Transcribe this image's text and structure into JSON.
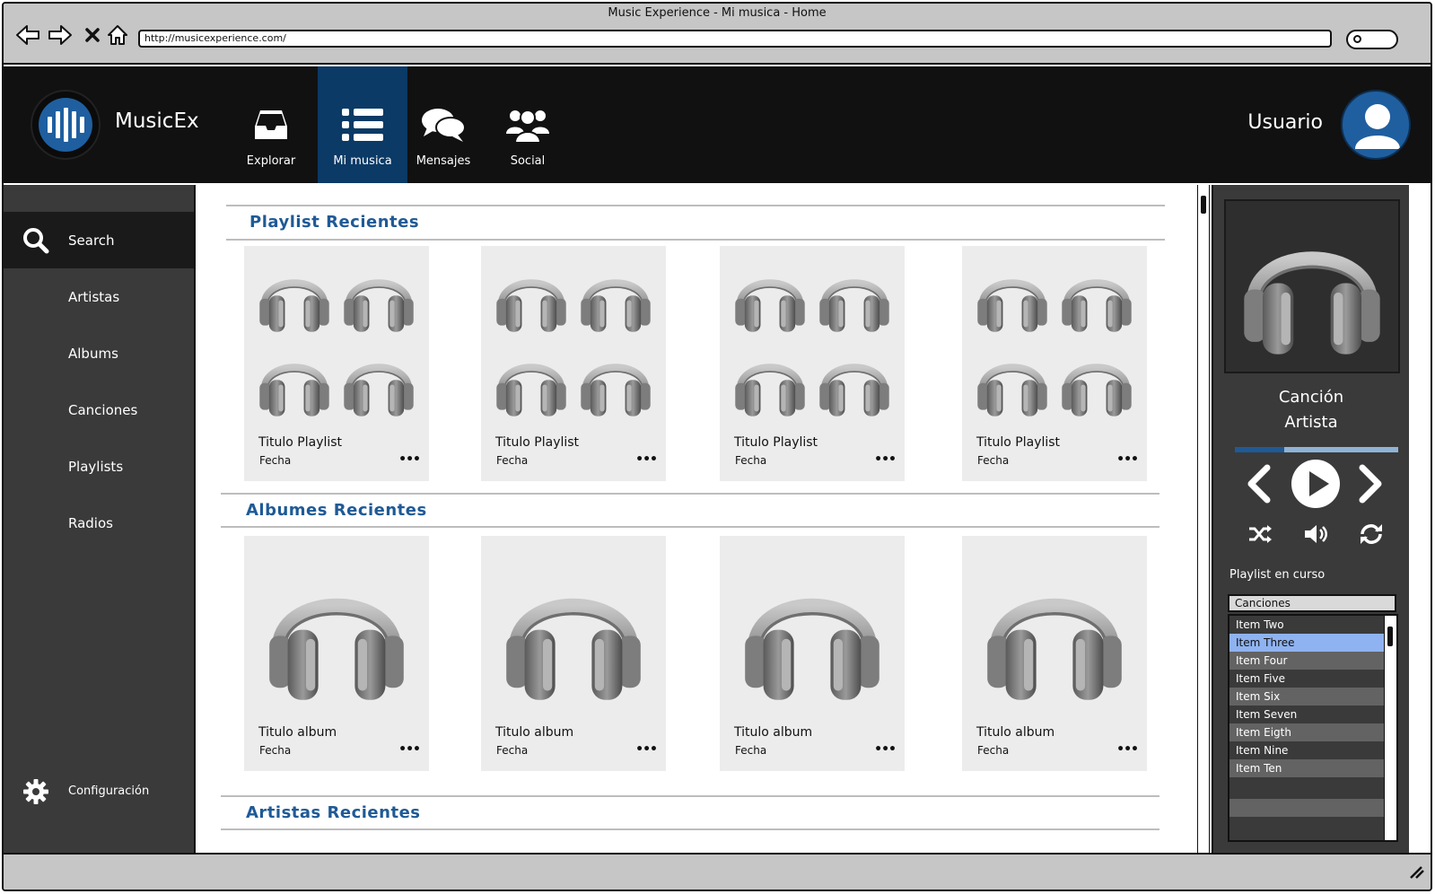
{
  "window": {
    "title": "Music Experience - Mi musica - Home"
  },
  "browser": {
    "url": "http://musicexperience.com/"
  },
  "icons": {
    "back": "back-arrow-icon",
    "forward": "forward-arrow-icon",
    "close": "close-icon",
    "home": "home-icon",
    "search": "search-icon",
    "settings": "gear-icon"
  },
  "colors": {
    "brand_blue": "#1f5a96",
    "active_nav": "#0b3a66",
    "header_bg": "#111111",
    "panel_bg": "#3a3a3a",
    "selected_item": "#8fb3f0"
  },
  "header": {
    "brand": "MusicEx",
    "tabs": [
      {
        "label": "Explorar",
        "icon": "inbox-icon"
      },
      {
        "label": "Mi musica",
        "icon": "list-icon",
        "active": true
      },
      {
        "label": "Mensajes",
        "icon": "chat-icon"
      },
      {
        "label": "Social",
        "icon": "users-icon"
      }
    ],
    "user": "Usuario"
  },
  "sidebar": {
    "items": [
      {
        "label": "Search",
        "active": true
      },
      {
        "label": "Artistas"
      },
      {
        "label": "Albums"
      },
      {
        "label": "Canciones"
      },
      {
        "label": "Playlists"
      },
      {
        "label": "Radios"
      }
    ],
    "config": "Configuración"
  },
  "main": {
    "playlists": {
      "title": "Playlist Recientes",
      "cards": [
        {
          "title": "Titulo Playlist",
          "date": "Fecha"
        },
        {
          "title": "Titulo Playlist",
          "date": "Fecha"
        },
        {
          "title": "Titulo Playlist",
          "date": "Fecha"
        },
        {
          "title": "Titulo Playlist",
          "date": "Fecha"
        }
      ]
    },
    "albums": {
      "title": "Albumes Recientes",
      "cards": [
        {
          "title": "Titulo album",
          "date": "Fecha"
        },
        {
          "title": "Titulo album",
          "date": "Fecha"
        },
        {
          "title": "Titulo album",
          "date": "Fecha"
        },
        {
          "title": "Titulo album",
          "date": "Fecha"
        }
      ]
    },
    "artists": {
      "title": "Artistas Recientes"
    },
    "more_label": "•••"
  },
  "player": {
    "song": "Canción",
    "artist": "Artista",
    "progress": 0.3,
    "playlist_label": "Playlist en curso",
    "playlist_select": "Canciones",
    "items": [
      "Item Two",
      "Item Three",
      "Item Four",
      "Item Five",
      "Item Six",
      "Item Seven",
      "Item Eigth",
      "Item Nine",
      "Item Ten"
    ],
    "selected_index": 1
  }
}
